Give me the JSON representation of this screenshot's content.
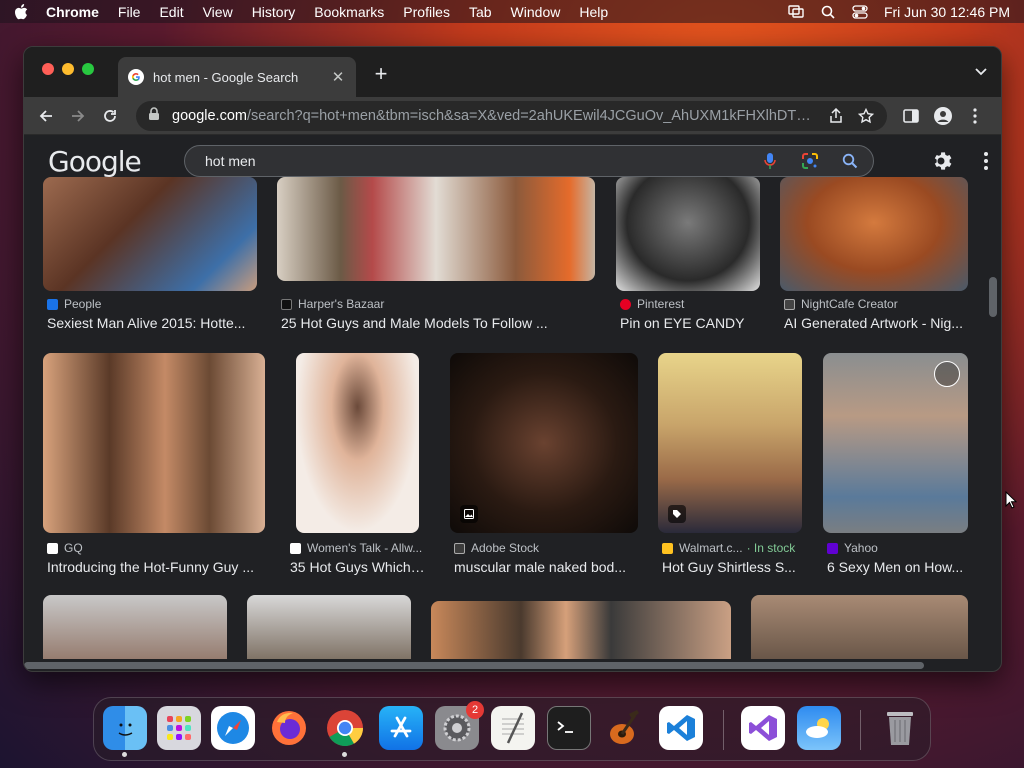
{
  "menubar": {
    "app": "Chrome",
    "items": [
      "File",
      "Edit",
      "View",
      "History",
      "Bookmarks",
      "Profiles",
      "Tab",
      "Window",
      "Help"
    ],
    "datetime": "Fri Jun 30  12:46 PM"
  },
  "tab": {
    "title": "hot men - Google Search"
  },
  "omnibox": {
    "host": "google.com",
    "path": "/search?q=hot+men&tbm=isch&sa=X&ved=2ahUKEwil4JCGuOv_AhUXM1kFHXlhDTE..."
  },
  "google": {
    "logo": "Google",
    "query": "hot men"
  },
  "results": [
    {
      "source": "People",
      "caption": "Sexiest Man Alive 2015: Hotte...",
      "fav": "#1a73e8"
    },
    {
      "source": "Harper's Bazaar",
      "caption": "25 Hot Guys and Male Models To Follow ...",
      "fav": "#111111"
    },
    {
      "source": "Pinterest",
      "caption": "Pin on EYE CANDY",
      "fav": "#e60023"
    },
    {
      "source": "NightCafe Creator",
      "caption": "AI Generated Artwork - Nig...",
      "fav": "#444444"
    },
    {
      "source": "GQ",
      "caption": "Introducing the Hot-Funny Guy ...",
      "fav": "#ffffff"
    },
    {
      "source": "Women's Talk - Allw...",
      "caption": "35 Hot Guys Which ...",
      "fav": "#ffffff"
    },
    {
      "source": "Adobe Stock",
      "caption": "muscular male naked bod...",
      "fav": "#3c3c3c"
    },
    {
      "source": "Walmart.c...",
      "stock": "· In stock",
      "caption": "Hot Guy Shirtless S...",
      "fav": "#ffc220"
    },
    {
      "source": "Yahoo",
      "caption": "6 Sexy Men on How...",
      "fav": "#6001d2"
    }
  ],
  "dock": {
    "badge_count": "2"
  }
}
